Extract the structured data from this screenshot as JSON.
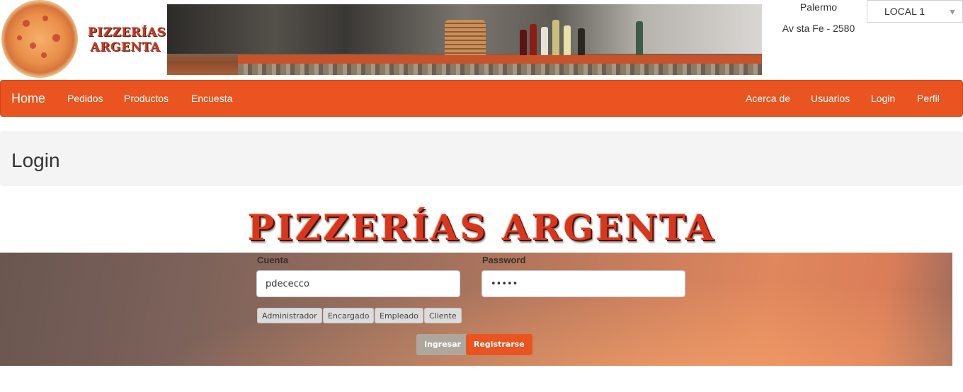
{
  "header": {
    "logo_text_line1": "PIZZERÍAS",
    "logo_text_line2": "ARGENTA",
    "location": {
      "city": "Palermo",
      "address": "Av sta Fe - 2580"
    },
    "local_select": {
      "selected": "LOCAL 1",
      "chevron_icon": "chevron-down-icon"
    }
  },
  "navbar": {
    "brand": "Home",
    "left_items": [
      "Pedidos",
      "Productos",
      "Encuesta"
    ],
    "right_items": [
      "Acerca de",
      "Usuarios",
      "Login",
      "Perfil"
    ]
  },
  "page": {
    "title": "Login",
    "big_title": "PIZZERÍAS ARGENTA"
  },
  "login_form": {
    "account_label": "Cuenta",
    "account_value": "pdececco",
    "password_label": "Password",
    "password_value": "•••••",
    "role_buttons": [
      "Administrador",
      "Encargado",
      "Empleado",
      "Cliente"
    ],
    "submit_label": "Ingresar",
    "register_label": "Registrarse"
  },
  "colors": {
    "accent": "#e95420",
    "secondary_button": "#aea79f",
    "page_header_bg": "#f4f4f4"
  }
}
